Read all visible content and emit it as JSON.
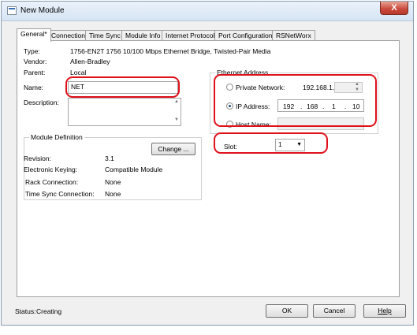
{
  "window": {
    "title": "New Module",
    "close_label": "X"
  },
  "tabs": [
    "General*",
    "Connection",
    "Time Sync",
    "Module Info",
    "Internet Protocol",
    "Port Configuration",
    "RSNetWorx"
  ],
  "general": {
    "type_label": "Type:",
    "type_value": "1756-EN2T 1756 10/100 Mbps Ethernet Bridge, Twisted-Pair Media",
    "vendor_label": "Vendor:",
    "vendor_value": "Allen-Bradley",
    "parent_label": "Parent:",
    "parent_value": "Local",
    "name_label": "Name:",
    "name_value": "NET",
    "description_label": "Description:",
    "description_value": ""
  },
  "ethernet": {
    "group_title": "Ethernet Address",
    "private_network_label": "Private Network:",
    "private_network_prefix": "192.168.1.",
    "ip_address_label": "IP Address:",
    "ip_octets": [
      "192",
      "168",
      "1",
      "10"
    ],
    "host_name_label": "Host Name:",
    "selected": "ip_address"
  },
  "slot": {
    "label": "Slot:",
    "value": "1"
  },
  "module_definition": {
    "title": "Module Definition",
    "change_label": "Change ...",
    "revision_label": "Revision:",
    "revision_value": "3.1",
    "keying_label": "Electronic Keying:",
    "keying_value": "Compatible Module",
    "rack_label": "Rack Connection:",
    "rack_value": "None",
    "timesync_label": "Time Sync Connection:",
    "timesync_value": "None"
  },
  "status": {
    "label": "Status:",
    "value": "Creating"
  },
  "buttons": {
    "ok": "OK",
    "cancel": "Cancel",
    "help": "Help"
  },
  "colors": {
    "highlight": "#e0101a",
    "window_border": "#8a9cb0"
  }
}
